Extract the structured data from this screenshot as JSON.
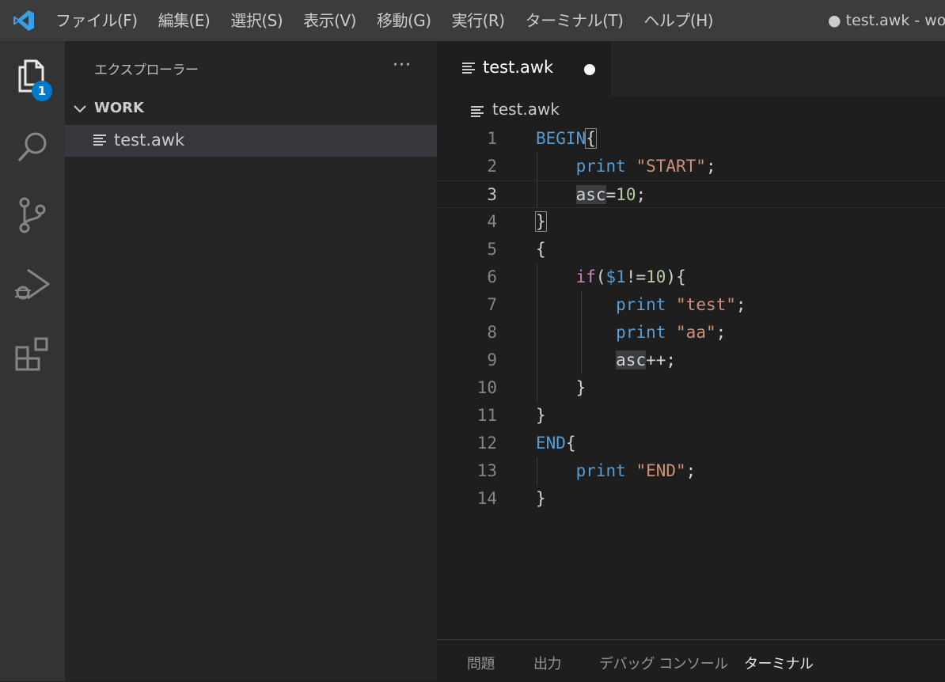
{
  "titlebar": {
    "menu": [
      "ファイル(F)",
      "編集(E)",
      "選択(S)",
      "表示(V)",
      "移動(G)",
      "実行(R)",
      "ターミナル(T)",
      "ヘルプ(H)"
    ],
    "window_title": "● test.awk - wo"
  },
  "activitybar": {
    "explorer_badge": "1"
  },
  "sidebar": {
    "title": "エクスプローラー",
    "more": "···",
    "workspace": "WORK",
    "files": [
      "test.awk"
    ]
  },
  "editor": {
    "tab_label": "test.awk",
    "breadcrumb": "test.awk",
    "line_numbers": [
      "1",
      "2",
      "3",
      "4",
      "5",
      "6",
      "7",
      "8",
      "9",
      "10",
      "11",
      "12",
      "13",
      "14"
    ],
    "current_line": 3
  },
  "code": {
    "l1_begin": "BEGIN",
    "l1_brace": "{",
    "l2_print": "print",
    "l2_str": "\"START\"",
    "l2_semi": ";",
    "l3_var": "asc",
    "l3_eq": "=",
    "l3_num": "10",
    "l3_semi": ";",
    "l4_brace": "}",
    "l5_brace": "{",
    "l6_if": "if",
    "l6_paren": "(",
    "l6_dollar": "$1",
    "l6_op": "!=",
    "l6_num": "10",
    "l6_close": "){",
    "l7_print": "print",
    "l7_str": "\"test\"",
    "l7_semi": ";",
    "l8_print": "print",
    "l8_str": "\"aa\"",
    "l8_semi": ";",
    "l9_var": "asc",
    "l9_op": "++;",
    "l10_brace": "}",
    "l11_brace": "}",
    "l12_end": "END",
    "l12_brace": "{",
    "l13_print": "print",
    "l13_str": "\"END\"",
    "l13_semi": ";",
    "l14_brace": "}"
  },
  "panel": {
    "tabs": [
      "問題",
      "出力",
      "デバッグ コンソール",
      "ターミナル"
    ],
    "active_tab": "ターミナル"
  },
  "colors": {
    "accent": "#007acc",
    "keyword": "#569cd6",
    "string": "#ce9178",
    "number": "#b5cea8",
    "control": "#c586c0"
  }
}
